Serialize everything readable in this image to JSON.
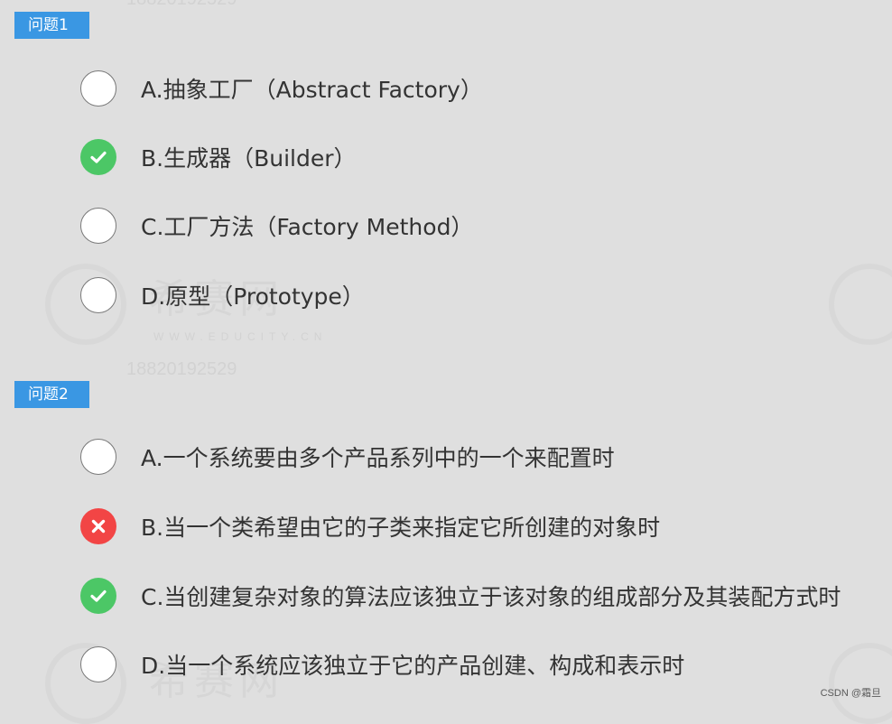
{
  "watermark": {
    "phone": "18820192529",
    "brand": "希赛网",
    "site": "WWW.EDUCITY.CN"
  },
  "questions": [
    {
      "label": "问题1",
      "options": [
        {
          "text": "A.抽象工厂（Abstract Factory）",
          "state": "unselected",
          "icon": "empty-radio"
        },
        {
          "text": "B.生成器（Builder）",
          "state": "correct",
          "icon": "check-icon"
        },
        {
          "text": "C.工厂方法（Factory Method）",
          "state": "unselected",
          "icon": "empty-radio"
        },
        {
          "text": "D.原型（Prototype）",
          "state": "unselected",
          "icon": "empty-radio"
        }
      ]
    },
    {
      "label": "问题2",
      "options": [
        {
          "text": "A.一个系统要由多个产品系列中的一个来配置时",
          "state": "unselected",
          "icon": "empty-radio"
        },
        {
          "text": "B.当一个类希望由它的子类来指定它所创建的对象时",
          "state": "wrong",
          "icon": "cross-icon"
        },
        {
          "text": "C.当创建复杂对象的算法应该独立于该对象的组成部分及其装配方式时",
          "state": "correct",
          "icon": "check-icon"
        },
        {
          "text": "D.当一个系统应该独立于它的产品创建、构成和表示时",
          "state": "unselected",
          "icon": "empty-radio"
        }
      ]
    }
  ],
  "credit": "CSDN @霜旦",
  "colors": {
    "tag": "#3a97e3",
    "correct": "#4cc766",
    "wrong": "#f24545",
    "background": "#dfdfdf"
  }
}
